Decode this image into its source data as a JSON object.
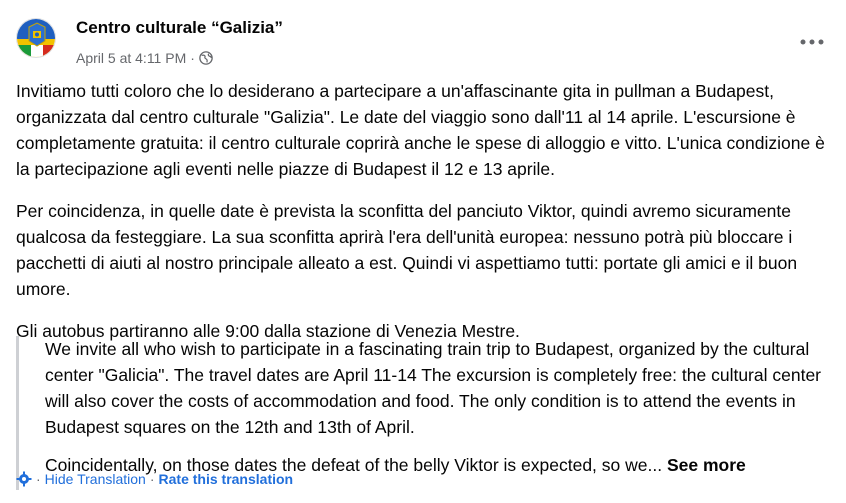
{
  "post": {
    "page_name": "Centro culturale “Galizia”",
    "timestamp": "April 5 at 4:11 PM",
    "separator": "·",
    "audience_icon": "globe-icon",
    "more_icon": "more-horizontal-icon",
    "paragraphs": [
      "Invitiamo tutti coloro che lo desiderano a partecipare a un'affascinante gita in pullman a Budapest, organizzata dal centro culturale \"Galizia\". Le date del viaggio sono dall'11 al 14 aprile. L'escursione è completamente gratuita: il centro culturale coprirà anche le spese di alloggio e vitto. L'unica condizione è la partecipazione agli eventi nelle piazze di Budapest il 12 e 13 aprile.",
      "Per coincidenza, in quelle date è prevista la sconfitta del panciuto Viktor, quindi avremo sicuramente qualcosa da festeggiare. La sua sconfitta aprirà l'era dell'unità europea: nessuno potrà più bloccare i pacchetti di aiuti al nostro principale alleato a est. Quindi vi aspettiamo tutti: portate gli amici e il buon umore.",
      "Gli autobus partiranno alle 9:00 dalla stazione di Venezia Mestre."
    ]
  },
  "translation": {
    "paragraph_1": "We invite all who wish to participate in a fascinating train trip to Budapest, organized by the cultural center \"Galicia\". The travel dates are April 11-14 The excursion is completely free: the cultural center will also cover the costs of accommodation and food. The only condition is to attend the events in Budapest squares on the 12th and 13th of April.",
    "paragraph_2": "Coincidentally, on those dates the defeat of the belly Viktor is expected, so we...",
    "see_more": "See more",
    "hide_label": "Hide Translation",
    "rate_label": "Rate this translation",
    "separator": "·",
    "icon": "translate-gear-icon"
  },
  "colors": {
    "link": "#216fdb",
    "muted": "#65676b",
    "quote_border": "#ced0d4"
  }
}
